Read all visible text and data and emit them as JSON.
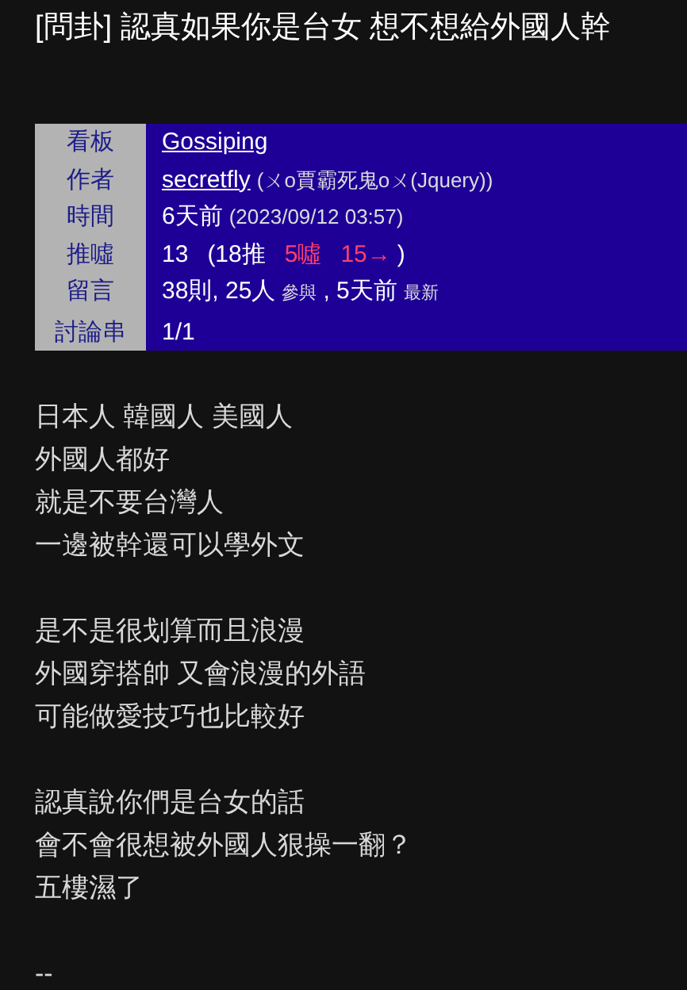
{
  "title": "[問卦] 認真如果你是台女 想不想給外國人幹",
  "meta": [
    {
      "label": "看板",
      "parts": [
        {
          "text": "Gossiping",
          "kind": "link"
        }
      ]
    },
    {
      "label": "作者",
      "parts": [
        {
          "text": "secretfly",
          "kind": "link"
        },
        {
          "text": "(ㄨo賈霸死鬼oㄨ(Jquery))",
          "kind": "small"
        }
      ]
    },
    {
      "label": "時間",
      "parts": [
        {
          "text": "6天前",
          "kind": "plain"
        },
        {
          "text": "(2023/09/12 03:57)",
          "kind": "small"
        }
      ]
    },
    {
      "label": "推噓",
      "parts": [
        {
          "text": "13",
          "kind": "plain"
        },
        {
          "text": "(18推",
          "kind": "plain"
        },
        {
          "text": "5噓",
          "kind": "alert"
        },
        {
          "text": "15→",
          "kind": "alert"
        },
        {
          "text": ")",
          "kind": "plain"
        }
      ]
    },
    {
      "label": "留言",
      "parts": [
        {
          "text": "38則, 25人",
          "kind": "plain"
        },
        {
          "text": "參與",
          "kind": "tiny"
        },
        {
          "text": ", 5天前",
          "kind": "plain"
        },
        {
          "text": "最新",
          "kind": "tiny"
        }
      ]
    },
    {
      "label": "討論串",
      "parts": [
        {
          "text": "1/1",
          "kind": "plain"
        }
      ]
    }
  ],
  "paragraphs": [
    [
      "日本人 韓國人 美國人",
      "外國人都好",
      "就是不要台灣人",
      "一邊被幹還可以學外文"
    ],
    [
      "是不是很划算而且浪漫",
      "外國穿搭帥 又會浪漫的外語",
      "可能做愛技巧也比較好"
    ],
    [
      "認真說你們是台女的話",
      "會不會很想被外國人狠操一翻？",
      "五樓濕了"
    ],
    [
      "--"
    ]
  ]
}
